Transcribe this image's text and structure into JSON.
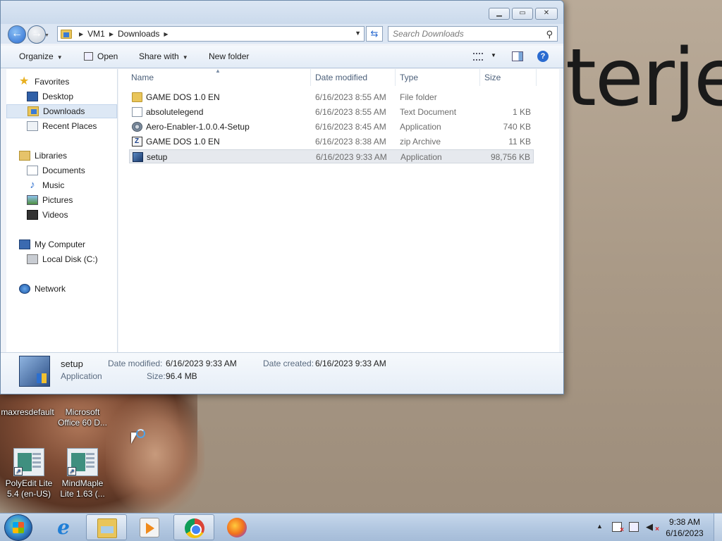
{
  "desktop": {
    "wallpaper_text": "terje",
    "icons": [
      {
        "label_line1": "maxresdefault",
        "label_line2": ""
      },
      {
        "label_line1": "Microsoft",
        "label_line2": "Office 60 D..."
      },
      {
        "label_line1": "PolyEdit Lite",
        "label_line2": "5.4 (en-US)"
      },
      {
        "label_line1": "MindMaple",
        "label_line2": "Lite 1.63 (..."
      }
    ]
  },
  "window": {
    "caption_buttons": {
      "minimize": "▁",
      "maximize": "▭",
      "close": "✕"
    },
    "address": {
      "crumbs": [
        "VM1",
        "Downloads"
      ]
    },
    "search": {
      "placeholder": "Search Downloads"
    },
    "toolbar": {
      "organize": "Organize",
      "open": "Open",
      "share_with": "Share with",
      "new_folder": "New folder"
    },
    "nav": {
      "favorites": "Favorites",
      "desktop": "Desktop",
      "downloads": "Downloads",
      "recent_places": "Recent Places",
      "libraries": "Libraries",
      "documents": "Documents",
      "music": "Music",
      "pictures": "Pictures",
      "videos": "Videos",
      "my_computer": "My Computer",
      "local_disk": "Local Disk (C:)",
      "network": "Network"
    },
    "columns": {
      "name": "Name",
      "date": "Date modified",
      "type": "Type",
      "size": "Size"
    },
    "files": [
      {
        "name": "GAME DOS 1.0 EN",
        "date": "6/16/2023 8:55 AM",
        "type": "File folder",
        "size": "",
        "icon": "folder-icon"
      },
      {
        "name": "absolutelegend",
        "date": "6/16/2023 8:55 AM",
        "type": "Text Document",
        "size": "1 KB",
        "icon": "text-file-icon"
      },
      {
        "name": "Aero-Enabler-1.0.0.4-Setup",
        "date": "6/16/2023 8:45 AM",
        "type": "Application",
        "size": "740 KB",
        "icon": "gear-app-icon"
      },
      {
        "name": "GAME DOS 1.0 EN",
        "date": "6/16/2023 8:38 AM",
        "type": "zip Archive",
        "size": "11 KB",
        "icon": "zip-icon"
      },
      {
        "name": "setup",
        "date": "6/16/2023 9:33 AM",
        "type": "Application",
        "size": "98,756 KB",
        "icon": "setup-app-icon",
        "selected": true
      }
    ],
    "details": {
      "name": "setup",
      "kind": "Application",
      "date_modified_label": "Date modified:",
      "date_modified": "6/16/2023 9:33 AM",
      "date_created_label": "Date created:",
      "date_created": "6/16/2023 9:33 AM",
      "size_label": "Size:",
      "size": "96.4 MB"
    }
  },
  "taskbar": {
    "apps": [
      "internet-explorer",
      "windows-explorer",
      "media-player",
      "chrome",
      "firefox"
    ],
    "clock": {
      "time": "9:38 AM",
      "date": "6/16/2023"
    }
  }
}
